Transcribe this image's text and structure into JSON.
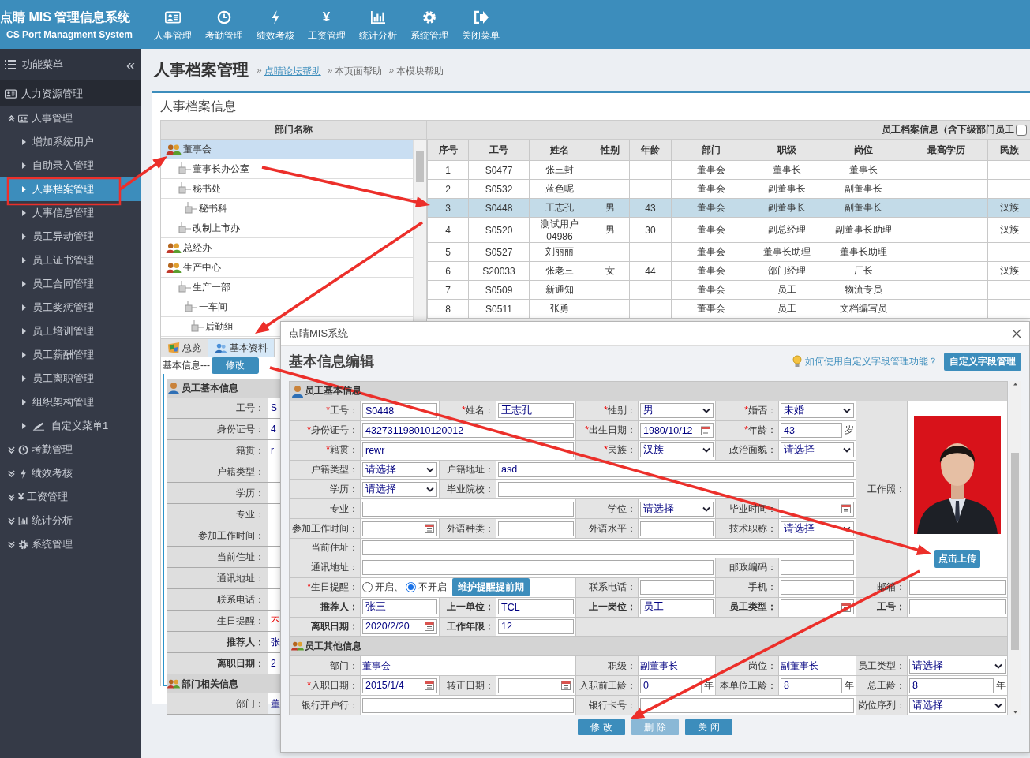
{
  "header": {
    "title": "点睛 MIS 管理信息系统",
    "subtitle": "CS Port Managment System",
    "nav": [
      {
        "label": "人事管理"
      },
      {
        "label": "考勤管理"
      },
      {
        "label": "绩效考核"
      },
      {
        "label": "工资管理",
        "glyph": "¥"
      },
      {
        "label": "统计分析"
      },
      {
        "label": "系统管理"
      },
      {
        "label": "关闭菜单"
      }
    ]
  },
  "sidebar": {
    "title": "功能菜单",
    "collapse_glyph": "«",
    "section": "人力资源管理",
    "items": [
      {
        "label": "人事管理",
        "expanded": true,
        "selected": false,
        "children": [
          {
            "label": "增加系统用户",
            "selected": false
          },
          {
            "label": "自助录入管理",
            "selected": false
          },
          {
            "label": "人事档案管理",
            "selected": true
          },
          {
            "label": "人事信息管理",
            "selected": false
          },
          {
            "label": "员工异动管理",
            "selected": false
          },
          {
            "label": "员工证书管理",
            "selected": false
          },
          {
            "label": "员工合同管理",
            "selected": false
          },
          {
            "label": "员工奖惩管理",
            "selected": false
          },
          {
            "label": "员工培训管理",
            "selected": false
          },
          {
            "label": "员工薪酬管理",
            "selected": false
          },
          {
            "label": "员工离职管理",
            "selected": false
          },
          {
            "label": "组织架构管理",
            "selected": false
          },
          {
            "label": "自定义菜单1",
            "selected": false
          }
        ]
      },
      {
        "label": "考勤管理",
        "expanded": false,
        "selected": false
      },
      {
        "label": "绩效考核",
        "expanded": false,
        "selected": false
      },
      {
        "label": "工资管理",
        "glyph": "¥",
        "expanded": false,
        "selected": false
      },
      {
        "label": "统计分析",
        "expanded": false,
        "selected": false
      },
      {
        "label": "系统管理",
        "expanded": false,
        "selected": false
      }
    ]
  },
  "page": {
    "title": "人事档案管理",
    "links": [
      {
        "marker": "»",
        "label": "点睛论坛帮助",
        "kind": "link"
      },
      {
        "marker": "»",
        "label": "本页面帮助",
        "kind": "plain"
      },
      {
        "marker": "»",
        "label": "本模块帮助",
        "kind": "plain"
      }
    ]
  },
  "card": {
    "title": "人事档案信息"
  },
  "dept_tree": {
    "column": "部门名称",
    "nodes": [
      {
        "label": "董事会",
        "selected": true,
        "children": [
          {
            "label": "董事长办公室",
            "selected": false
          },
          {
            "label": "秘书处",
            "selected": false,
            "children": [
              {
                "label": "秘书科",
                "selected": false
              }
            ]
          },
          {
            "label": "改制上市办",
            "selected": false
          }
        ]
      },
      {
        "label": "总经办",
        "selected": false
      },
      {
        "label": "生产中心",
        "selected": false,
        "children": [
          {
            "label": "生产一部",
            "selected": false,
            "children": [
              {
                "label": "一车间",
                "selected": false,
                "children": [
                  {
                    "label": "后勤组",
                    "selected": false
                  }
                ]
              }
            ]
          }
        ]
      }
    ]
  },
  "employee_table": {
    "caption": "员工档案信息（含下级部门员工",
    "include_sub": false,
    "columns": [
      "序号",
      "工号",
      "姓名",
      "性别",
      "年龄",
      "部门",
      "职级",
      "岗位",
      "最高学历",
      "民族"
    ],
    "rows": [
      {
        "no": "1",
        "id": "S0477",
        "name": "张三封",
        "dept": "董事会",
        "rank": "董事长",
        "post": "董事长",
        "selected": false
      },
      {
        "no": "2",
        "id": "S0532",
        "name": "蓝色呢",
        "dept": "董事会",
        "rank": "副董事长",
        "post": "副董事长",
        "selected": false
      },
      {
        "no": "3",
        "id": "S0448",
        "name": "王志孔",
        "sex": "男",
        "age": "43",
        "dept": "董事会",
        "rank": "副董事长",
        "post": "副董事长",
        "nation": "汉族",
        "selected": true
      },
      {
        "no": "4",
        "id": "S0520",
        "name": "测试用户04986",
        "sex": "男",
        "age": "30",
        "dept": "董事会",
        "rank": "副总经理",
        "post": "副董事长助理",
        "nation": "汉族",
        "selected": false
      },
      {
        "no": "5",
        "id": "S0527",
        "name": "刘丽丽",
        "dept": "董事会",
        "rank": "董事长助理",
        "post": "董事长助理",
        "selected": false
      },
      {
        "no": "6",
        "id": "S20033",
        "name": "张老三",
        "sex": "女",
        "age": "44",
        "dept": "董事会",
        "rank": "部门经理",
        "post": "厂长",
        "nation": "汉族",
        "selected": false
      },
      {
        "no": "7",
        "id": "S0509",
        "name": "新通知",
        "dept": "董事会",
        "rank": "员工",
        "post": "物流专员",
        "selected": false
      },
      {
        "no": "8",
        "id": "S0511",
        "name": "张勇",
        "dept": "董事会",
        "rank": "员工",
        "post": "文档编写员",
        "selected": false
      }
    ]
  },
  "detail_tabs": [
    {
      "label": "总览",
      "selected": false
    },
    {
      "label": "基本资料",
      "selected": true
    }
  ],
  "detail": {
    "legend": "基本信息---",
    "edit_button": "修改",
    "sections": [
      {
        "title": "员工基本信息",
        "rows": [
          {
            "label": "工号：",
            "value": "S"
          },
          {
            "label": "身份证号：",
            "value": "4"
          },
          {
            "label": "籍贯：",
            "value": "r"
          },
          {
            "label": "户籍类型："
          },
          {
            "label": "学历："
          },
          {
            "label": "专业："
          },
          {
            "label": "参加工作时间："
          },
          {
            "label": "当前住址："
          },
          {
            "label": "通讯地址："
          },
          {
            "label": "联系电话："
          },
          {
            "label": "生日提醒：",
            "value": "不",
            "alert": true
          },
          {
            "label": "推荐人：",
            "value": "张",
            "bold": true
          },
          {
            "label": "离职日期：",
            "value": "2",
            "bold": true
          }
        ]
      },
      {
        "title": "部门相关信息",
        "rows": [
          {
            "label": "部门：",
            "value": "董"
          }
        ]
      }
    ]
  },
  "dialog": {
    "title": "点睛MIS系统",
    "heading": "基本信息编辑",
    "help_link": "如何使用自定义字段管理功能？",
    "custom_button": "自定义字段管理",
    "sections": [
      {
        "title": "员工基本信息",
        "photo": {
          "label": "工作照：",
          "button": "点击上传"
        },
        "rows": [
          {
            "fields": [
              {
                "label": "工号：",
                "mark": "*",
                "kind": "input",
                "value": "S0448"
              },
              {
                "label": "姓名：",
                "mark": "*",
                "kind": "input",
                "value": "王志孔"
              },
              {
                "label": "性别：",
                "mark": "*",
                "kind": "select",
                "value": "男"
              },
              {
                "label": "婚否：",
                "mark": "*",
                "kind": "select",
                "value": "未婚"
              }
            ]
          },
          {
            "fields": [
              {
                "label": "身份证号：",
                "mark": "*",
                "kind": "input",
                "value": "432731198010120012"
              },
              {
                "label": "出生日期：",
                "mark": "*",
                "kind": "date",
                "value": "1980/10/12"
              },
              {
                "label": "年龄：",
                "mark": "*",
                "kind": "unit",
                "value": "43",
                "unit": "岁"
              }
            ]
          },
          {
            "fields": [
              {
                "label": "籍贯：",
                "mark": "*",
                "kind": "input",
                "value": "rewr"
              },
              {
                "label": "民族：",
                "mark": "*",
                "kind": "select",
                "value": "汉族"
              },
              {
                "label": "政治面貌：",
                "kind": "select",
                "value": "请选择"
              }
            ]
          },
          {
            "fields": [
              {
                "label": "户籍类型：",
                "kind": "select",
                "value": "请选择"
              },
              {
                "label": "户籍地址：",
                "kind": "input",
                "value": "asd"
              }
            ]
          },
          {
            "fields": [
              {
                "label": "学历：",
                "kind": "select",
                "value": "请选择"
              },
              {
                "label": "毕业院校：",
                "kind": "input"
              }
            ]
          },
          {
            "fields": [
              {
                "label": "专业：",
                "kind": "input"
              },
              {
                "label": "学位：",
                "kind": "select",
                "value": "请选择"
              },
              {
                "label": "毕业时间：",
                "kind": "date"
              }
            ]
          },
          {
            "fields": [
              {
                "label": "参加工作时间：",
                "kind": "date"
              },
              {
                "label": "外语种类：",
                "kind": "input"
              },
              {
                "label": "外语水平：",
                "kind": "input"
              },
              {
                "label": "技术职称：",
                "kind": "select",
                "value": "请选择"
              }
            ]
          },
          {
            "fields": [
              {
                "label": "当前住址：",
                "kind": "input"
              }
            ]
          },
          {
            "fields": [
              {
                "label": "通讯地址：",
                "kind": "input"
              },
              {
                "label": "邮政编码：",
                "kind": "input"
              }
            ]
          },
          {
            "fields": [
              {
                "label": "生日提醒：",
                "mark": "*",
                "kind": "radio",
                "options": [
                  {
                    "label": "开启、",
                    "selected": false
                  },
                  {
                    "label": "不开启",
                    "selected": true
                  }
                ],
                "button": "维护提醒提前期"
              },
              {
                "label": "联系电话：",
                "kind": "input"
              },
              {
                "label": "手机：",
                "kind": "input"
              },
              {
                "label": "邮箱：",
                "kind": "input"
              }
            ]
          },
          {
            "fields": [
              {
                "label": "推荐人：",
                "bold": true,
                "kind": "input",
                "value": "张三"
              },
              {
                "label": "上一单位：",
                "bold": true,
                "kind": "input",
                "value": "TCL"
              },
              {
                "label": "上一岗位：",
                "bold": true,
                "kind": "input",
                "value": "员工"
              },
              {
                "label": "员工类型：",
                "bold": true,
                "kind": "date"
              },
              {
                "label": "工号：",
                "bold": true,
                "kind": "input"
              }
            ]
          },
          {
            "fields": [
              {
                "label": "离职日期：",
                "bold": true,
                "kind": "date",
                "value": "2020/2/20"
              },
              {
                "label": "工作年限：",
                "bold": true,
                "kind": "input",
                "value": "12"
              }
            ]
          }
        ]
      },
      {
        "title": "员工其他信息",
        "rows": [
          {
            "fields": [
              {
                "label": "部门：",
                "kind": "text",
                "value": "董事会"
              },
              {
                "label": "职级：",
                "kind": "text",
                "value": "副董事长"
              },
              {
                "label": "岗位：",
                "kind": "text",
                "value": "副董事长"
              },
              {
                "label": "员工类型：",
                "kind": "select",
                "value": "请选择"
              }
            ]
          },
          {
            "fields": [
              {
                "label": "入职日期：",
                "mark": "*",
                "kind": "date",
                "value": "2015/1/4"
              },
              {
                "label": "转正日期：",
                "kind": "date"
              },
              {
                "label": "入职前工龄：",
                "kind": "unit",
                "value": "0",
                "unit": "年"
              },
              {
                "label": "本单位工龄：",
                "kind": "unit",
                "value": "8",
                "unit": "年"
              },
              {
                "label": "总工龄：",
                "kind": "unit",
                "value": "8",
                "unit": "年"
              }
            ]
          },
          {
            "fields": [
              {
                "label": "银行开户行：",
                "kind": "input"
              },
              {
                "label": "银行卡号：",
                "kind": "input"
              },
              {
                "label": "岗位序列：",
                "kind": "select",
                "value": "请选择"
              }
            ]
          }
        ]
      }
    ],
    "buttons": [
      {
        "label": "修 改",
        "disabled": false
      },
      {
        "label": "删 除",
        "disabled": true
      },
      {
        "label": "关 闭",
        "disabled": false
      }
    ]
  }
}
